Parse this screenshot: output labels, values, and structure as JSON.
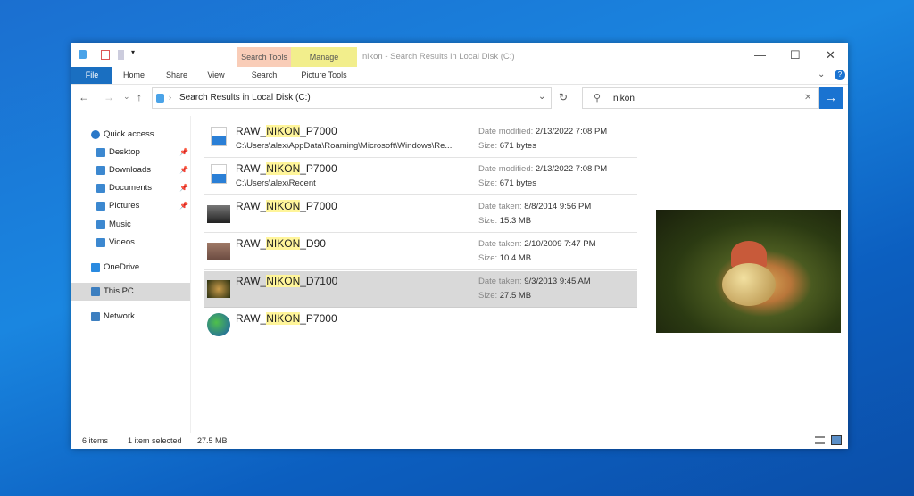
{
  "window": {
    "title": "nikon - Search Results in Local Disk (C:)",
    "context_tabs": [
      "Search Tools",
      "Manage"
    ],
    "ribbon_tabs": [
      "File",
      "Home",
      "Share",
      "View",
      "Search",
      "Picture Tools"
    ]
  },
  "address": {
    "breadcrumb": "Search Results in Local Disk (C:)"
  },
  "search": {
    "value": "nikon"
  },
  "nav": [
    {
      "label": "Quick access",
      "icon": "star-icon"
    },
    {
      "label": "Desktop",
      "icon": "desktop-icon",
      "pinned": true
    },
    {
      "label": "Downloads",
      "icon": "download-icon",
      "pinned": true
    },
    {
      "label": "Documents",
      "icon": "documents-icon",
      "pinned": true
    },
    {
      "label": "Pictures",
      "icon": "pictures-icon",
      "pinned": true
    },
    {
      "label": "Music",
      "icon": "music-icon"
    },
    {
      "label": "Videos",
      "icon": "videos-icon"
    },
    {
      "label": "OneDrive",
      "icon": "cloud-icon"
    },
    {
      "label": "This PC",
      "icon": "pc-icon",
      "selected": true
    },
    {
      "label": "Network",
      "icon": "network-icon"
    }
  ],
  "files": [
    {
      "pre": "RAW_",
      "hl": "NIKON",
      "post": "_P7000",
      "path": "C:\\Users\\alex\\AppData\\Roaming\\Microsoft\\Windows\\Re...",
      "k1": "Date modified:",
      "v1": "2/13/2022 7:08 PM",
      "k2": "Size:",
      "v2": "671 bytes"
    },
    {
      "pre": "RAW_",
      "hl": "NIKON",
      "post": "_P7000",
      "path": "C:\\Users\\alex\\Recent",
      "k1": "Date modified:",
      "v1": "2/13/2022 7:08 PM",
      "k2": "Size:",
      "v2": "671 bytes"
    },
    {
      "pre": "RAW_",
      "hl": "NIKON",
      "post": "_P7000",
      "path": "",
      "k1": "Date taken:",
      "v1": "8/8/2014 9:56 PM",
      "k2": "Size:",
      "v2": "15.3 MB"
    },
    {
      "pre": "RAW_",
      "hl": "NIKON",
      "post": "_D90",
      "path": "",
      "k1": "Date taken:",
      "v1": "2/10/2009 7:47 PM",
      "k2": "Size:",
      "v2": "10.4 MB"
    },
    {
      "pre": "RAW_",
      "hl": "NIKON",
      "post": "_D7100",
      "path": "",
      "k1": "Date taken:",
      "v1": "9/3/2013 9:45 AM",
      "k2": "Size:",
      "v2": "27.5 MB",
      "selected": true
    },
    {
      "pre": "RAW_",
      "hl": "NIKON",
      "post": "_P7000",
      "path": "",
      "k1": "",
      "v1": "",
      "k2": "",
      "v2": ""
    }
  ],
  "status": {
    "count": "6 items",
    "selected": "1 item selected",
    "size": "27.5 MB"
  },
  "colors": {
    "accent": "#1a73d1",
    "search_tools": "#f9cdb8",
    "manage": "#f2ee8c",
    "highlight": "#fff59a"
  }
}
